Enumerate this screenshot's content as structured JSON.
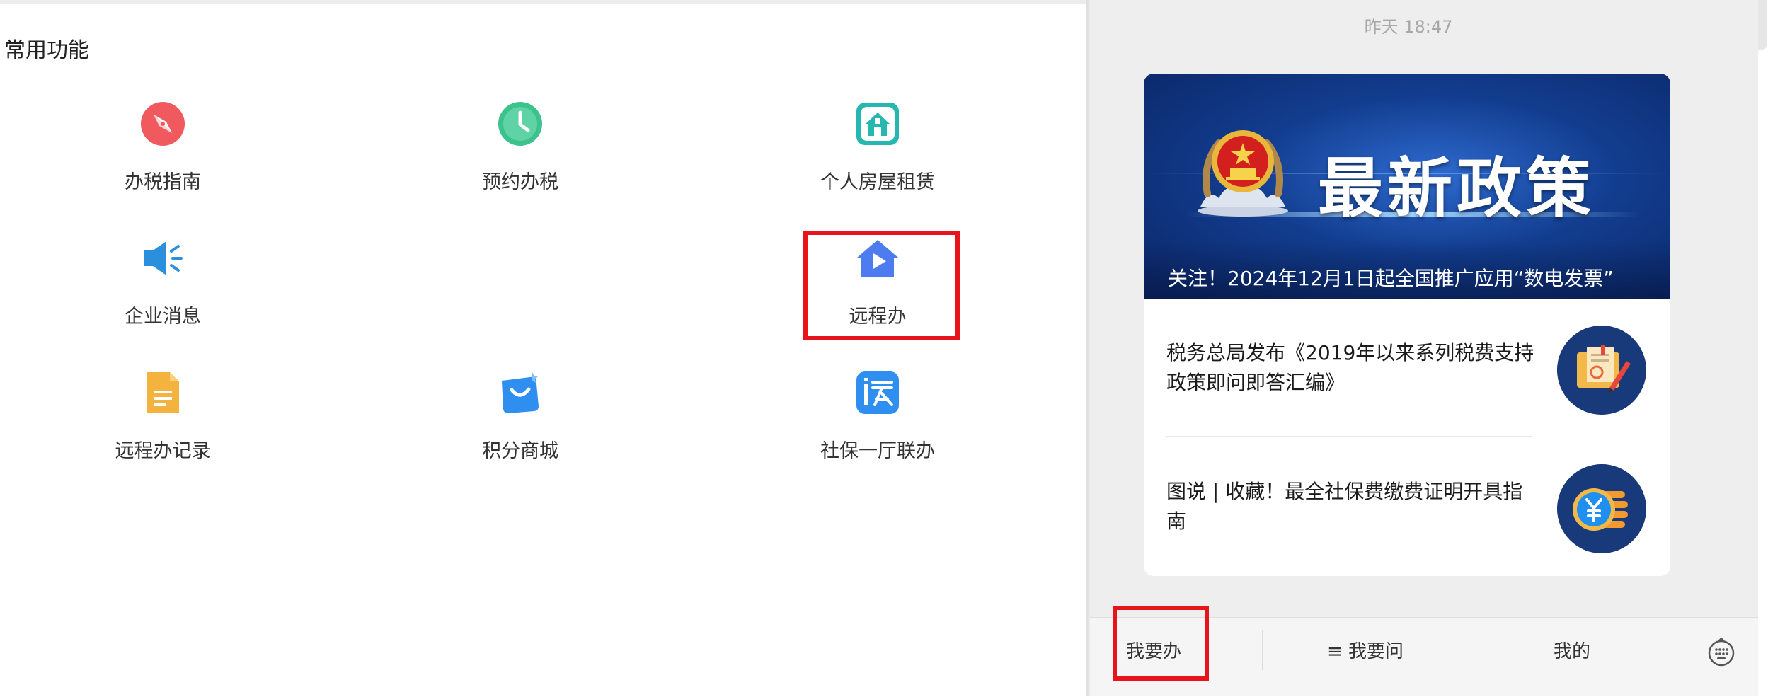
{
  "left_panel": {
    "section_title": "常用功能",
    "functions": [
      {
        "label": "办税指南",
        "icon": "compass-icon",
        "color": "#f05a5f"
      },
      {
        "label": "预约办税",
        "icon": "clock-icon",
        "color": "#3cc28d"
      },
      {
        "label": "个人房屋租赁",
        "icon": "house-rent-icon",
        "color": "#25b7b0"
      },
      {
        "label": "企业消息",
        "icon": "megaphone-icon",
        "color": "#2a8fdc"
      },
      {
        "label": "远程办",
        "icon": "remote-house-play-icon",
        "color": "#4d7cf0",
        "highlighted": true
      },
      {
        "label": "远程办记录",
        "icon": "document-icon",
        "color": "#f4b33e"
      },
      {
        "label": "积分商城",
        "icon": "shopping-bag-icon",
        "color": "#2f8ff0"
      },
      {
        "label": "社保一厅联办",
        "icon": "social-security-icon",
        "color": "#2f8ff0"
      }
    ]
  },
  "chat": {
    "timestamp": "昨天 18:47",
    "banner": {
      "title": "最新政策",
      "caption": "关注！2024年12月1日起全国推广应用“数电发票”"
    },
    "news": [
      {
        "title": "税务总局发布《2019年以来系列税费支持政策即问即答汇编》",
        "thumb_icon": "document-pen-icon"
      },
      {
        "title": "图说 | 收藏！最全社保费缴费证明开具指南",
        "thumb_icon": "yuan-coin-icon"
      }
    ]
  },
  "bottom_menu": {
    "items": [
      "我要办",
      "≡ 我要问",
      "我的"
    ],
    "keyboard_icon": "keyboard-icon",
    "highlighted": "我要办"
  },
  "colors": {
    "highlight": "#e8141b",
    "banner": "#123d8f",
    "panel_bg": "#eeeeee"
  }
}
